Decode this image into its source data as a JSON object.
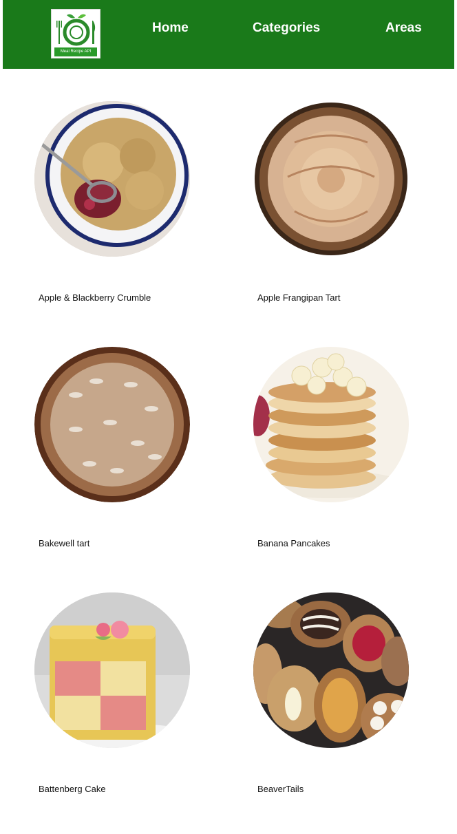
{
  "header": {
    "logo_text": "Meal Recipe API",
    "nav": [
      {
        "label": "Home"
      },
      {
        "label": "Categories"
      },
      {
        "label": "Areas"
      }
    ]
  },
  "meals": [
    {
      "name": "Apple & Blackberry Crumble"
    },
    {
      "name": "Apple Frangipan Tart"
    },
    {
      "name": "Bakewell tart"
    },
    {
      "name": "Banana Pancakes"
    },
    {
      "name": "Battenberg Cake"
    },
    {
      "name": "BeaverTails"
    }
  ],
  "colors": {
    "navbar": "#1a7a1a",
    "nav_text": "#ffffff",
    "card_text": "#111111"
  }
}
